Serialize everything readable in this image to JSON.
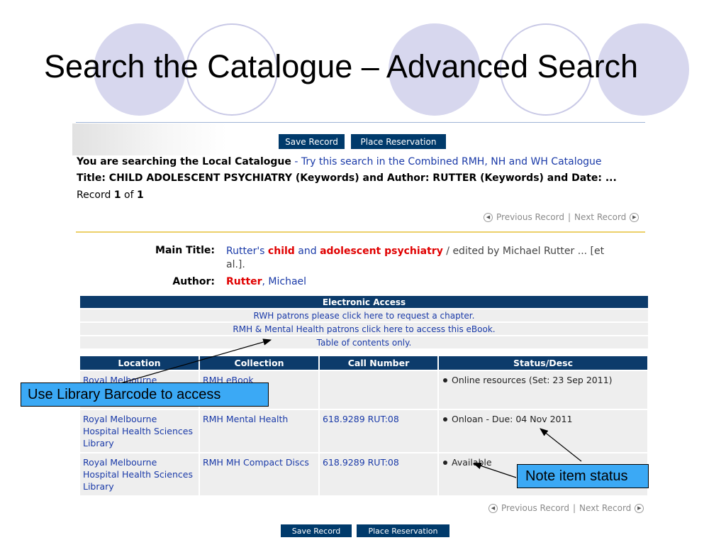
{
  "slide": {
    "title": "Search the Catalogue – Advanced Search"
  },
  "record_page": {
    "buttons": {
      "save_record": "Save Record",
      "place_reservation": "Place Reservation"
    },
    "search_info": {
      "prefix": "You are searching the Local Catalogue",
      "separator": " - ",
      "combined_link": "Try this search in the Combined RMH, NH and WH Catalogue",
      "query": "Title: CHILD ADOLESCENT PSYCHIATRY (Keywords) and Author: RUTTER (Keywords) and Date: ...",
      "record_label": "Record",
      "record_current": "1",
      "record_of": "of",
      "record_total": "1"
    },
    "record_nav": {
      "previous": "Previous Record",
      "separator": "|",
      "next": "Next Record"
    },
    "main_title": {
      "label": "Main Title:",
      "part1": "Rutter's ",
      "hl1": "child",
      "part2": " and ",
      "hl2": "adolescent psychiatry",
      "part3": " / edited by Michael Rutter ... [et",
      "part4": "al.]."
    },
    "author": {
      "label": "Author:",
      "hl": "Rutter",
      "rest": ", Michael"
    },
    "electronic_access": {
      "header": "Electronic Access",
      "links": [
        "RWH patrons please click here to request a chapter.",
        "RMH & Mental Health patrons click here to access this eBook.",
        "Table of contents only."
      ]
    },
    "holdings": {
      "columns": [
        "Location",
        "Collection",
        "Call Number",
        "Status/Desc"
      ],
      "rows": [
        {
          "location": "Royal Melbourne",
          "collection": "RMH eBook",
          "call_number": "",
          "status": "Online resources (Set: 23 Sep 2011)"
        },
        {
          "location": "Royal Melbourne Hospital Health Sciences Library",
          "collection": "RMH Mental Health",
          "call_number": "618.9289 RUT:08",
          "status": "Onloan - Due: 04 Nov 2011"
        },
        {
          "location": "Royal Melbourne Hospital Health Sciences Library",
          "collection": "RMH MH Compact Discs",
          "call_number": "618.9289 RUT:08",
          "status": "Available"
        }
      ]
    }
  },
  "callouts": {
    "barcode": "Use Library Barcode to access",
    "status": "Note item status"
  },
  "colors": {
    "callout_bg": "#3ba9f5",
    "nav_blue": "#0c3b6b",
    "highlight_red": "#e00000",
    "link_blue": "#1a3aa8",
    "circle_fill": "#d7d7ee"
  }
}
